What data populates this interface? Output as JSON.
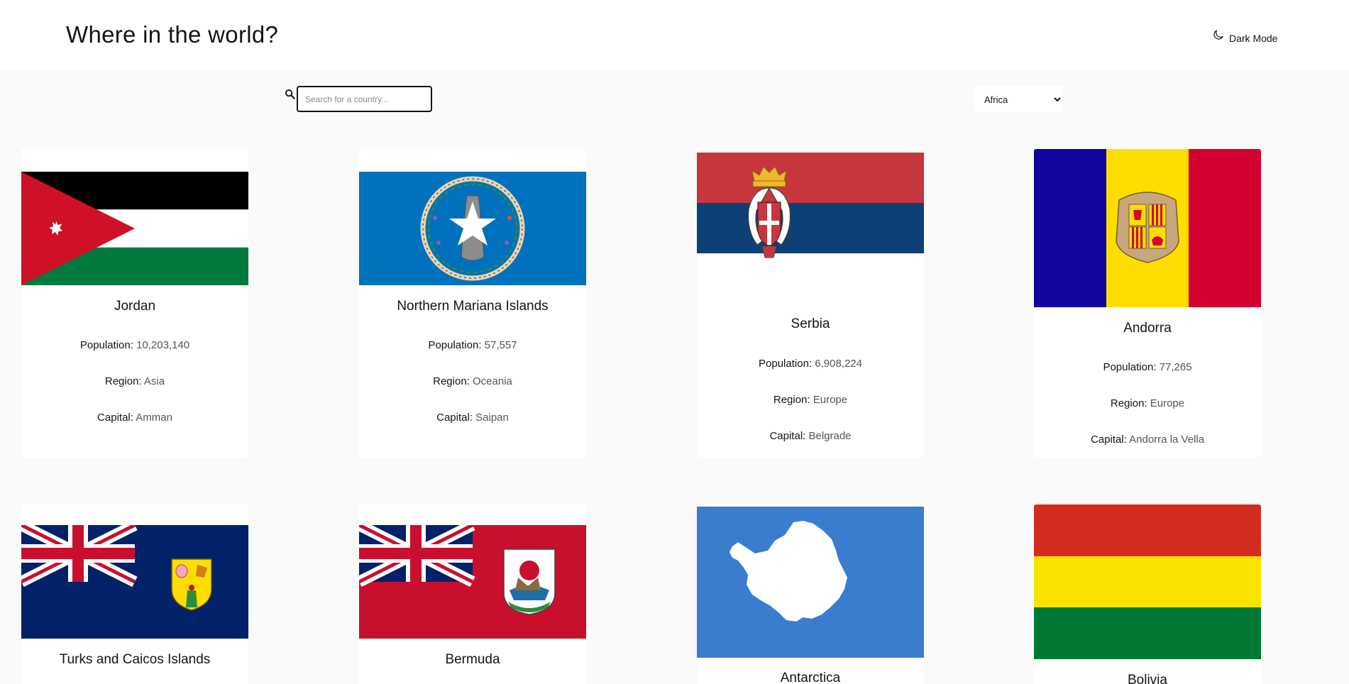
{
  "header": {
    "title": "Where in the world?",
    "dark_mode_label": "Dark Mode",
    "dark_mode_icon": "moon-icon"
  },
  "search": {
    "placeholder": "Search for a country...",
    "value": "",
    "icon": "search-icon"
  },
  "filter": {
    "selected": "Africa"
  },
  "labels": {
    "population": "Population:",
    "region": "Region:",
    "capital": "Capital:"
  },
  "countries": [
    {
      "name": "Jordan",
      "population": "10,203,140",
      "region": "Asia",
      "capital": "Amman"
    },
    {
      "name": "Northern Mariana Islands",
      "population": "57,557",
      "region": "Oceania",
      "capital": "Saipan"
    },
    {
      "name": "Serbia",
      "population": "6,908,224",
      "region": "Europe",
      "capital": "Belgrade"
    },
    {
      "name": "Andorra",
      "population": "77,265",
      "region": "Europe",
      "capital": "Andorra la Vella"
    },
    {
      "name": "Turks and Caicos Islands"
    },
    {
      "name": "Bermuda"
    },
    {
      "name": "Antarctica"
    },
    {
      "name": "Bolivia"
    }
  ],
  "colors": {
    "background": "#fafafa",
    "card": "#ffffff",
    "text": "#111517",
    "value_text": "#555555"
  }
}
